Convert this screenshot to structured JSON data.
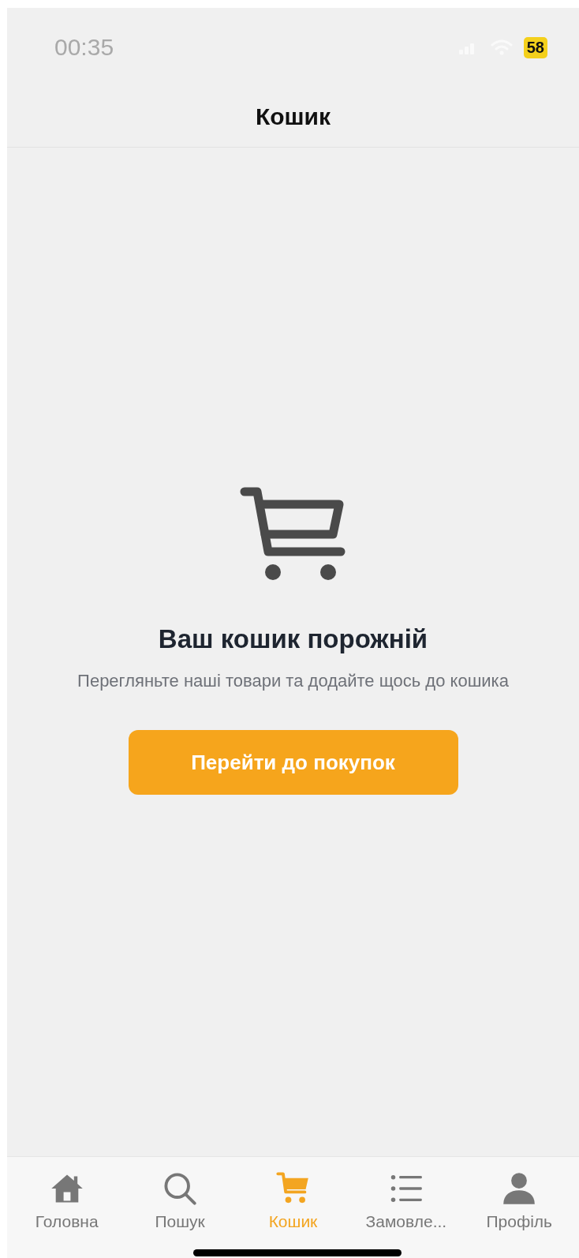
{
  "status_bar": {
    "time": "00:35",
    "battery": "58"
  },
  "header": {
    "title": "Кошик"
  },
  "empty_state": {
    "title": "Ваш кошик порожній",
    "message": "Перегляньте наші товари та додайте щось до кошика",
    "button": "Перейти до покупок"
  },
  "tab_bar": [
    {
      "kind": "home",
      "label": "Головна",
      "selected": false
    },
    {
      "kind": "search",
      "label": "Пошук",
      "selected": false
    },
    {
      "kind": "cart",
      "label": "Кошик",
      "selected": true
    },
    {
      "kind": "orders",
      "label": "Замовле...",
      "selected": false
    },
    {
      "kind": "profile",
      "label": "Профіль",
      "selected": false
    }
  ]
}
